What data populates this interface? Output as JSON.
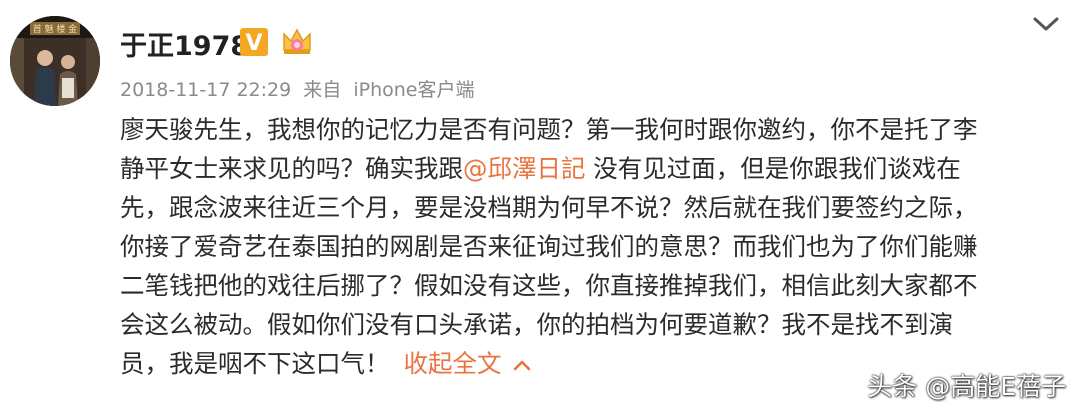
{
  "post": {
    "author": {
      "name": "于正1978",
      "verified_badge": "V",
      "avatar_sign_text": "首 魅 楼 金"
    },
    "meta": {
      "timestamp": "2018-11-17 22:29",
      "source_prefix": "来自",
      "source": "iPhone客户端"
    },
    "body": {
      "lines": [
        {
          "text": "廖天骏先生，我想你的记忆力是否有问题？第一我何时跟你邀约，你不是托了李"
        },
        {
          "before": "静平女士来求见的吗？确实我跟",
          "mention": "@邱澤日記",
          "after": " 没有见过面，但是你跟我们谈戏在"
        },
        {
          "text": "先，跟念波来往近三个月，要是没档期为何早不说？然后就在我们要签约之际，"
        },
        {
          "text": "你接了爱奇艺在泰国拍的网剧是否来征询过我们的意思？而我们也为了你们能赚"
        },
        {
          "text": "二笔钱把他的戏往后挪了？假如没有这些，你直接推掉我们，相信此刻大家都不"
        },
        {
          "text": "会这么被动。假如你们没有口头承诺，你的拍档为何要道歉？我不是找不到演"
        },
        {
          "text": "员，我是咽不下这口气！",
          "collapse": "收起全文"
        }
      ]
    }
  },
  "watermark": "头条 @高能E蓓子",
  "colors": {
    "link": "#eb7340",
    "meta": "#8a8a8a",
    "text": "#2b2b2b",
    "vip_badge": "#f5a623"
  },
  "icons": {
    "menu": "chevron-down-icon",
    "badge": "crown-icon",
    "collapse": "chevron-up-icon"
  }
}
